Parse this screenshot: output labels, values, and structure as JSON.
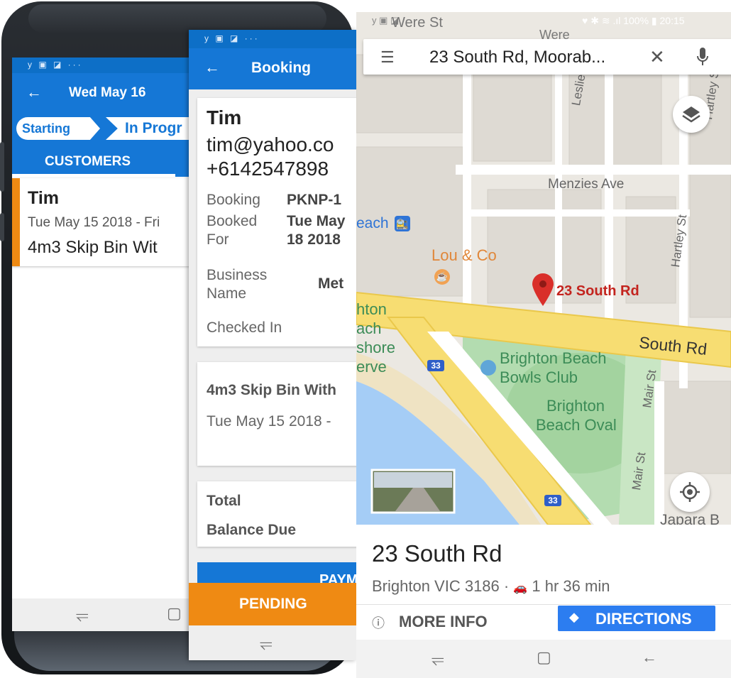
{
  "phone1": {
    "status_icons": "y ▣ ◪ ···",
    "appbar": {
      "back_icon": "arrow-left-icon",
      "title": "Wed May 16"
    },
    "stage_tabs": [
      "Starting",
      "In Progr"
    ],
    "section_tab": "CUSTOMERS",
    "customer": {
      "name": "Tim",
      "dates": "Tue May 15 2018 - Fri",
      "product": "4m3 Skip Bin Wit"
    }
  },
  "phone2": {
    "status_icons": "y ▣ ◪ ···",
    "appbar": {
      "back_icon": "arrow-left-icon",
      "title": "Booking"
    },
    "contact": {
      "name": "Tim",
      "email": "tim@yahoo.co",
      "phone": "+6142547898"
    },
    "details": {
      "booking_label": "Booking",
      "booking_value": "PKNP-1",
      "booked_for_label_1": "Booked",
      "booked_for_label_2": "For",
      "booked_for_value_1": "Tue May",
      "booked_for_value_2": "18 2018",
      "business_label_1": "Business",
      "business_label_2": "Name",
      "business_value": "Met",
      "checked_in_label": "Checked In"
    },
    "item": {
      "title": "4m3 Skip Bin With",
      "dates": "Tue May 15 2018 -"
    },
    "totals": {
      "total_label": "Total",
      "balance_label": "Balance Due"
    },
    "pay_button": "PAYM",
    "pending_button": "PENDING"
  },
  "phone3": {
    "status_left": "y ▣ ◪",
    "status_right": "♥ ✱ ≋ .ıl 100% ▮ 20:15",
    "search": {
      "query": "23 South Rd, Moorab...",
      "menu_icon": "hamburger-icon",
      "clear_icon": "close-icon",
      "mic_icon": "microphone-icon"
    },
    "map_labels": {
      "were_st": "Were St",
      "were_st_2": "Were",
      "leslie_gr": "Leslie Gr",
      "menzies_ave": "Menzies Ave",
      "hartley_st": "Hartley St",
      "hartley_st_2": "Hartley St",
      "station": "each",
      "lou_co": "Lou & Co",
      "pin_label": "23 South Rd",
      "brighton_beach_1": "hton",
      "brighton_beach_2": "ach",
      "foreshore_1": "shore",
      "foreshore_2": "erve",
      "route_shield": "33",
      "route_shield_2": "33",
      "south_rd": "South Rd",
      "bowls_1": "Brighton Beach",
      "bowls_2": "Bowls Club",
      "oval_1": "Brighton",
      "oval_2": "Beach Oval",
      "mair_st": "Mair St",
      "mair_st_2": "Mair St",
      "japara": "Japara B"
    },
    "sheet": {
      "place": "23 South Rd",
      "sub": "Brighton VIC 3186 · ",
      "drive_time": "1 hr 36 min",
      "more_info": "MORE INFO",
      "directions": "DIRECTIONS"
    },
    "colors": {
      "brand_blue": "#1577d6",
      "pending_orange": "#ef8a13",
      "maps_blue": "#2c7df0",
      "pin_red": "#d92f2a"
    }
  }
}
